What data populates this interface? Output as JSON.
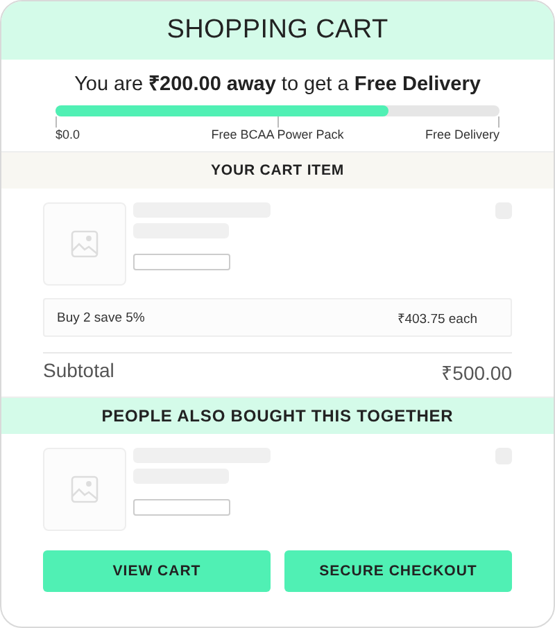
{
  "title": "SHOPPING CART",
  "delivery": {
    "message": "You are **₹200.00 away** to get a **Free Delivery**",
    "level": 0.75,
    "milestones": [
      {
        "label": "$0.0"
      },
      {
        "label": "Free BCAA Power Pack"
      },
      {
        "label": "Free Delivery"
      }
    ]
  },
  "cart_section": {
    "heading": "YOUR CART ITEM",
    "offer": {
      "label": "Buy 2 save 5%",
      "price": "₹403.75 each"
    },
    "subtotal": {
      "label": "Subtotal",
      "value": "₹500.00"
    }
  },
  "also_bought": {
    "heading": "PEOPLE ALSO BOUGHT THIS TOGETHER"
  },
  "buttons": [
    {
      "label": "VIEW CART"
    },
    {
      "label": "SECURE CHECKOUT"
    }
  ]
}
